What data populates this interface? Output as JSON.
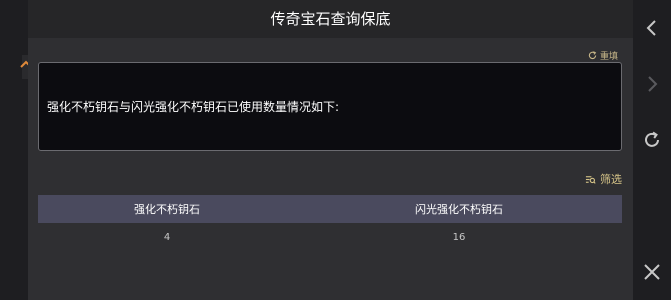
{
  "dialog": {
    "title": "传奇宝石查询保底",
    "reset_label": "重填",
    "info_text": "强化不朽钥石与闪光强化不朽钥石已使用数量情况如下:",
    "filter_label": "筛选"
  },
  "table": {
    "headers": [
      "强化不朽钥石",
      "闪光强化不朽钥石"
    ],
    "rows": [
      [
        "4",
        "16"
      ]
    ]
  },
  "icons": {
    "reset": "refresh-icon",
    "filter": "filter-icon",
    "nav_back": "chevron-left-icon",
    "nav_forward": "chevron-right-icon",
    "nav_refresh": "refresh-icon",
    "nav_close": "close-icon"
  },
  "colors": {
    "accent": "#d6c488",
    "header_row": "#4a4a5e",
    "background": "#2f2f32"
  }
}
